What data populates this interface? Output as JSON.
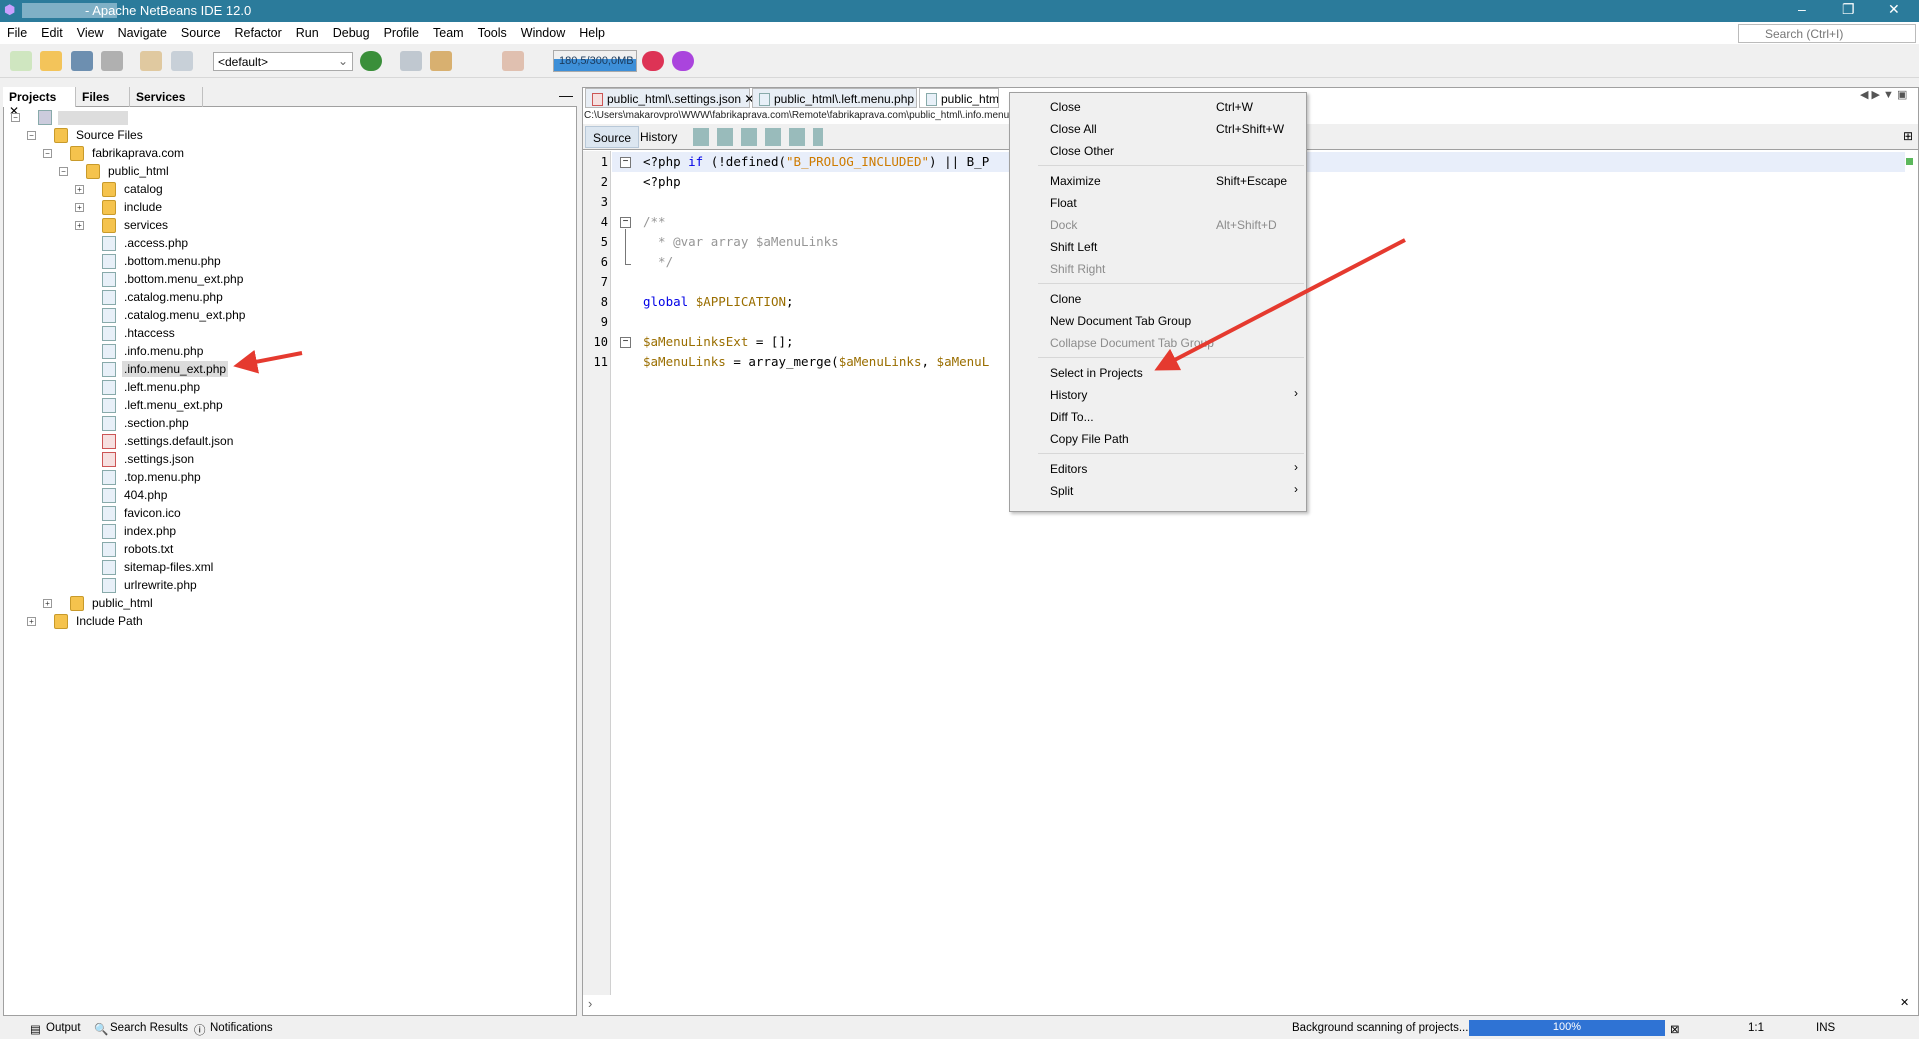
{
  "window": {
    "title": "- Apache NetBeans IDE 12.0",
    "controls": [
      "–",
      "❐",
      "✕"
    ]
  },
  "menu": [
    "File",
    "Edit",
    "View",
    "Navigate",
    "Source",
    "Refactor",
    "Run",
    "Debug",
    "Profile",
    "Team",
    "Tools",
    "Window",
    "Help"
  ],
  "search": {
    "placeholder": "Search (Ctrl+I)"
  },
  "toolbar": {
    "config": "<default>",
    "memory": "180,5/300,0MB"
  },
  "left_panel": {
    "tabs": [
      "Projects",
      "Files",
      "Services"
    ],
    "tree": [
      {
        "label": "",
        "level": 0,
        "type": "project",
        "toggle": "-"
      },
      {
        "label": "Source Files",
        "level": 1,
        "type": "folder",
        "toggle": "-"
      },
      {
        "label": "fabrikaprava.com",
        "level": 2,
        "type": "folder",
        "toggle": "-"
      },
      {
        "label": "public_html",
        "level": 3,
        "type": "folder",
        "toggle": "-"
      },
      {
        "label": "catalog",
        "level": 4,
        "type": "folder",
        "toggle": "+"
      },
      {
        "label": "include",
        "level": 4,
        "type": "folder",
        "toggle": "+"
      },
      {
        "label": "services",
        "level": 4,
        "type": "folder",
        "toggle": "+"
      },
      {
        "label": ".access.php",
        "level": 4,
        "type": "php"
      },
      {
        "label": ".bottom.menu.php",
        "level": 4,
        "type": "php"
      },
      {
        "label": ".bottom.menu_ext.php",
        "level": 4,
        "type": "php"
      },
      {
        "label": ".catalog.menu.php",
        "level": 4,
        "type": "php"
      },
      {
        "label": ".catalog.menu_ext.php",
        "level": 4,
        "type": "php"
      },
      {
        "label": ".htaccess",
        "level": 4,
        "type": "htaccess"
      },
      {
        "label": ".info.menu.php",
        "level": 4,
        "type": "php"
      },
      {
        "label": ".info.menu_ext.php",
        "level": 4,
        "type": "php",
        "selected": true
      },
      {
        "label": ".left.menu.php",
        "level": 4,
        "type": "php"
      },
      {
        "label": ".left.menu_ext.php",
        "level": 4,
        "type": "php"
      },
      {
        "label": ".section.php",
        "level": 4,
        "type": "php"
      },
      {
        "label": ".settings.default.json",
        "level": 4,
        "type": "json"
      },
      {
        "label": ".settings.json",
        "level": 4,
        "type": "json"
      },
      {
        "label": ".top.menu.php",
        "level": 4,
        "type": "php"
      },
      {
        "label": "404.php",
        "level": 4,
        "type": "php"
      },
      {
        "label": "favicon.ico",
        "level": 4,
        "type": "file"
      },
      {
        "label": "index.php",
        "level": 4,
        "type": "php"
      },
      {
        "label": "robots.txt",
        "level": 4,
        "type": "file"
      },
      {
        "label": "sitemap-files.xml",
        "level": 4,
        "type": "xml"
      },
      {
        "label": "urlrewrite.php",
        "level": 4,
        "type": "php"
      },
      {
        "label": "public_html",
        "level": 2,
        "type": "folder",
        "toggle": "+"
      },
      {
        "label": "Include Path",
        "level": 1,
        "type": "folder",
        "toggle": "+"
      }
    ]
  },
  "editor": {
    "tabs": [
      "public_html\\.settings.json",
      "public_html\\.left.menu.php",
      "public_html\\.in"
    ],
    "path": "C:\\Users\\makarovpro\\WWW\\fabrikaprava.com\\Remote\\fabrikaprava.com\\public_html\\.info.menu_ext.ph",
    "source_tabs": [
      "Source",
      "History"
    ],
    "lines": [
      [
        [
          "<?php ",
          ""
        ],
        [
          "if",
          "kw"
        ],
        [
          " (!defined(",
          ""
        ],
        [
          "\"B_PROLOG_INCLUDED\"",
          "str"
        ],
        [
          ") || B_P",
          ""
        ]
      ],
      [
        [
          "<?php",
          ""
        ]
      ],
      [],
      [
        [
          "/**",
          "cm"
        ]
      ],
      [
        [
          "  * @var array $aMenuLinks",
          "cm"
        ]
      ],
      [
        [
          "  */",
          "cm"
        ]
      ],
      [],
      [
        [
          "global",
          "kw"
        ],
        [
          " ",
          ""
        ],
        [
          "$APPLICATION",
          "var"
        ],
        [
          ";",
          ""
        ]
      ],
      [],
      [
        [
          "$aMenuLinksExt",
          "var"
        ],
        [
          " = [];",
          ""
        ]
      ],
      [
        [
          "$aMenuLinks",
          "var"
        ],
        [
          " = array_merge(",
          ""
        ],
        [
          "$aMenuLinks",
          "var"
        ],
        [
          ", ",
          ""
        ],
        [
          "$aMenuL",
          "var"
        ]
      ]
    ],
    "folds": [
      1,
      4,
      10
    ]
  },
  "context_menu": [
    {
      "label": "Close",
      "shortcut": "Ctrl+W"
    },
    {
      "label": "Close All",
      "shortcut": "Ctrl+Shift+W"
    },
    {
      "label": "Close Other"
    },
    {
      "sep": true
    },
    {
      "label": "Maximize",
      "shortcut": "Shift+Escape"
    },
    {
      "label": "Float"
    },
    {
      "label": "Dock",
      "shortcut": "Alt+Shift+D",
      "disabled": true
    },
    {
      "label": "Shift Left"
    },
    {
      "label": "Shift Right",
      "disabled": true
    },
    {
      "sep": true
    },
    {
      "label": "Clone"
    },
    {
      "label": "New Document Tab Group"
    },
    {
      "label": "Collapse Document Tab Group",
      "disabled": true
    },
    {
      "sep": true
    },
    {
      "label": "Select in Projects"
    },
    {
      "label": "History",
      "submenu": true
    },
    {
      "label": "Diff To..."
    },
    {
      "label": "Copy File Path"
    },
    {
      "sep": true
    },
    {
      "label": "Editors",
      "submenu": true
    },
    {
      "label": "Split",
      "submenu": true
    }
  ],
  "status": {
    "output": "Output",
    "search_results": "Search Results",
    "notifications": "Notifications",
    "scan": "Background scanning of projects...",
    "progress": "100%",
    "position": "1:1",
    "mode": "INS"
  },
  "colors": {
    "titlebar": "#2b7b9b",
    "annotation_arrow": "#e53a2f",
    "progress": "#2f73d4"
  }
}
